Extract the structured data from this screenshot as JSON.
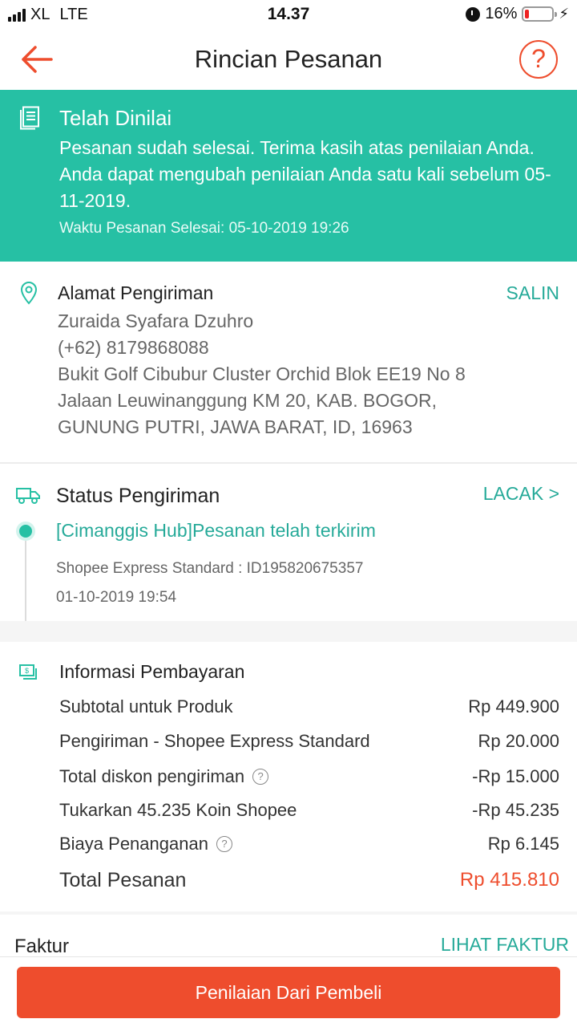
{
  "status_bar": {
    "carrier": "XL",
    "network": "LTE",
    "time": "14.37",
    "battery": "16%",
    "battery_level": 0.16
  },
  "header": {
    "title": "Rincian Pesanan",
    "help_glyph": "?"
  },
  "banner": {
    "title": "Telah Dinilai",
    "message": "Pesanan sudah selesai. Terima kasih atas penilaian Anda. Anda dapat mengubah penilaian Anda satu kali sebelum 05-11-2019.",
    "completed_time": "Waktu Pesanan Selesai: 05-10-2019 19:26",
    "color": "#26c0a4"
  },
  "address": {
    "title": "Alamat Pengiriman",
    "copy_label": "SALIN",
    "name": "Zuraida Syafara Dzuhro",
    "phone": "(+62) 8179868088",
    "line1": "Bukit Golf Cibubur Cluster Orchid Blok EE19 No 8",
    "line2": "Jalaan Leuwinanggung KM 20, KAB. BOGOR,",
    "line3": "GUNUNG PUTRI, JAWA BARAT, ID, 16963"
  },
  "shipping": {
    "title": "Status Pengiriman",
    "track_label": "LACAK >",
    "latest_status": "[Cimanggis Hub]Pesanan telah terkirim",
    "service": "Shopee Express Standard :  ID195820675357",
    "date": "01-10-2019 19:54"
  },
  "payment": {
    "title": "Informasi Pembayaran",
    "rows": [
      {
        "label": "Subtotal untuk Produk",
        "value": "Rp 449.900"
      },
      {
        "label": "Pengiriman - Shopee Express Standard",
        "value": "Rp 20.000"
      },
      {
        "label": "Total diskon pengiriman",
        "value": "-Rp 15.000"
      },
      {
        "label": "Tukarkan 45.235 Koin Shopee",
        "value": "-Rp 45.235"
      },
      {
        "label": "Biaya Penanganan",
        "value": "Rp 6.145"
      }
    ],
    "total_label": "Total Pesanan",
    "total_value": "Rp 415.810"
  },
  "invoice": {
    "title": "Faktur",
    "link_label": "LIHAT FAKTUR"
  },
  "bottom": {
    "button_label": "Penilaian Dari Pembeli"
  },
  "colors": {
    "accent": "#ee4d2d",
    "teal": "#26aa99"
  }
}
